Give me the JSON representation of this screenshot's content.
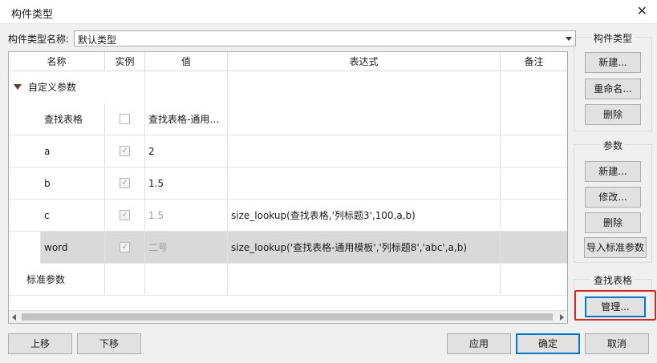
{
  "window": {
    "title": "构件类型",
    "close_glyph": "✕"
  },
  "type_name": {
    "label": "构件类型名称:",
    "value": "默认类型"
  },
  "table": {
    "headers": [
      "名称",
      "实例",
      "值",
      "表达式",
      "备注"
    ],
    "group_custom": "自定义参数",
    "rows": [
      {
        "name": "查找表格",
        "instance": false,
        "value": "查找表格-通用…",
        "expression": "",
        "note": ""
      },
      {
        "name": "a",
        "instance": true,
        "value": "2",
        "expression": "",
        "note": ""
      },
      {
        "name": "b",
        "instance": true,
        "value": "1.5",
        "expression": "",
        "note": ""
      },
      {
        "name": "c",
        "instance": true,
        "value": "1.5",
        "expression": "size_lookup(查找表格,'列标题3',100,a,b)",
        "note": ""
      },
      {
        "name": "word",
        "instance": true,
        "value": "二号",
        "expression": "size_lookup('查找表格-通用模板','列标题8','abc',a,b)",
        "note": ""
      }
    ],
    "group_standard": "标准参数"
  },
  "panels": {
    "component_type": {
      "title": "构件类型",
      "new": "新建...",
      "rename": "重命名...",
      "delete": "删除"
    },
    "params": {
      "title": "参数",
      "new": "新建...",
      "modify": "修改...",
      "delete": "删除",
      "import": "导入标准参数"
    },
    "lookup": {
      "title": "查找表格",
      "manage": "管理..."
    }
  },
  "footer": {
    "move_up": "上移",
    "move_down": "下移",
    "apply": "应用",
    "ok": "确定",
    "cancel": "取消"
  },
  "colors": {
    "highlight": "#e0241b",
    "primary_border": "#0078d7",
    "selected_row": "#d9d9d9"
  }
}
